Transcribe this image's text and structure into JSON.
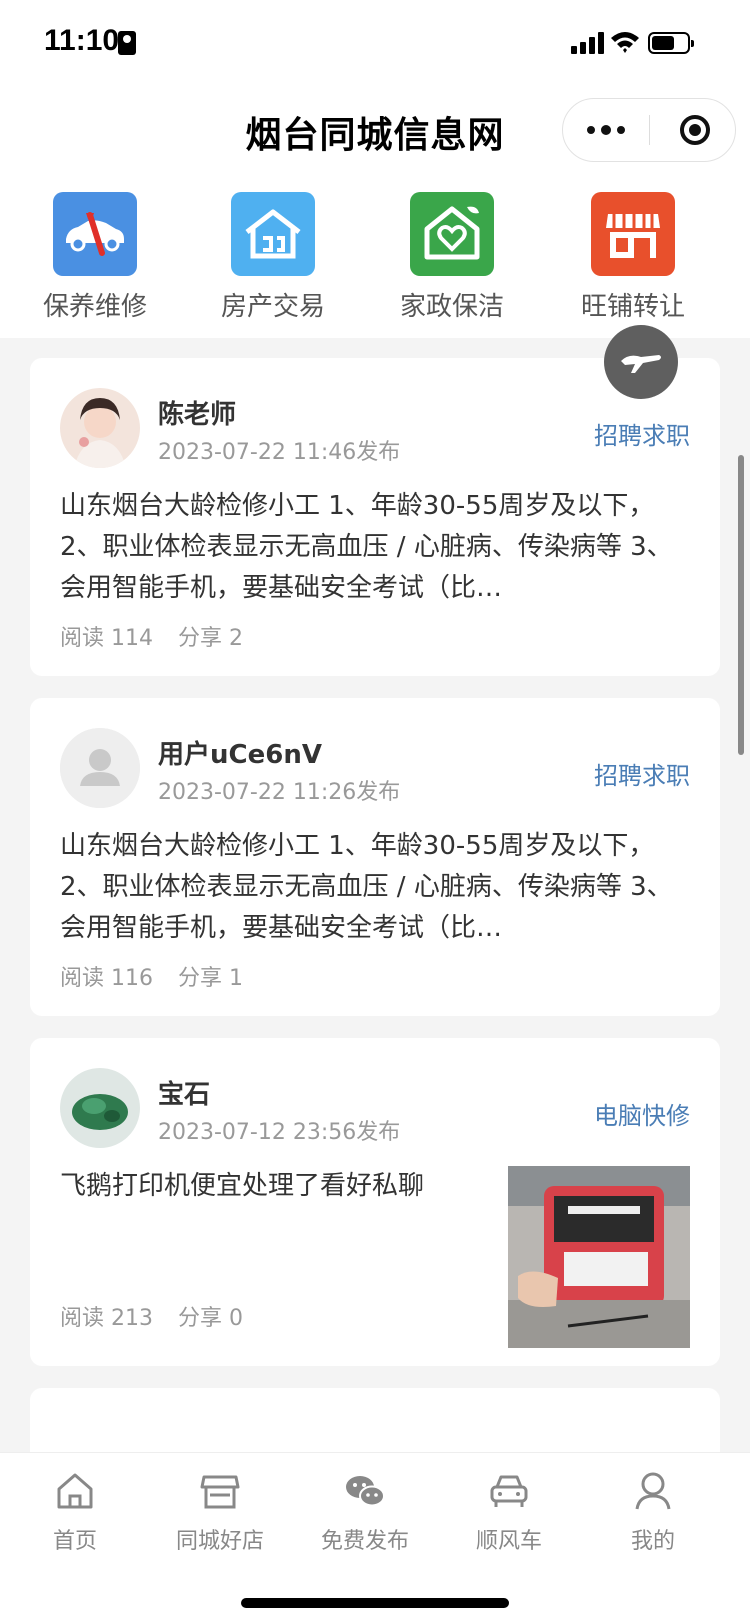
{
  "status_bar": {
    "time": "11:10"
  },
  "nav": {
    "title": "烟台同城信息网"
  },
  "categories": [
    {
      "label": "保养维修",
      "icon": "car-repair-icon",
      "color": "#4a90e2"
    },
    {
      "label": "房产交易",
      "icon": "house-icon",
      "color": "#4fb0f0"
    },
    {
      "label": "家政保洁",
      "icon": "home-heart-icon",
      "color": "#3aa64a"
    },
    {
      "label": "旺铺转让",
      "icon": "storefront-icon",
      "color": "#e8502c"
    }
  ],
  "posts": [
    {
      "author": "陈老师",
      "time": "2023-07-22 11:46发布",
      "tag": "招聘求职",
      "text": "山东烟台大龄检修小工 1、年龄30-55周岁及以下， 2、职业体检表显示无高血压 / 心脏病、传染病等 3、会用智能手机，要基础安全考试（比…",
      "reads": "阅读 114",
      "shares": "分享 2"
    },
    {
      "author": "用户uCe6nV",
      "time": "2023-07-22 11:26发布",
      "tag": "招聘求职",
      "text": "山东烟台大龄检修小工 1、年龄30-55周岁及以下， 2、职业体检表显示无高血压 / 心脏病、传染病等 3、会用智能手机，要基础安全考试（比…",
      "reads": "阅读 116",
      "shares": "分享 1"
    },
    {
      "author": "宝石",
      "time": "2023-07-12 23:56发布",
      "tag": "电脑快修",
      "text": "飞鹅打印机便宜处理了看好私聊",
      "reads": "阅读 213",
      "shares": "分享 0"
    }
  ],
  "tabs": [
    {
      "label": "首页",
      "icon": "home-icon"
    },
    {
      "label": "同城好店",
      "icon": "shop-icon"
    },
    {
      "label": "免费发布",
      "icon": "wechat-icon"
    },
    {
      "label": "顺风车",
      "icon": "car-icon"
    },
    {
      "label": "我的",
      "icon": "user-icon"
    }
  ],
  "colors": {
    "tag": "#4a7db5",
    "background": "#f4f4f4"
  }
}
